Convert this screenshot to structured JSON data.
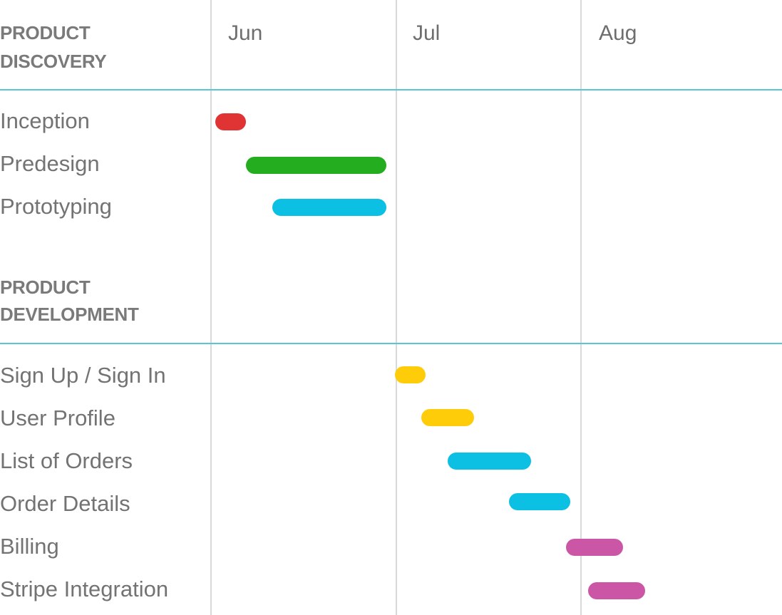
{
  "chart_data": {
    "type": "gantt",
    "title": "",
    "months": [
      "Jun",
      "Jul",
      "Aug"
    ],
    "x_unit": "weeks from start of Jun",
    "groups": [
      {
        "title_lines": [
          "PRODUCT",
          "DISCOVERY"
        ],
        "tasks": [
          {
            "name": "Inception",
            "start": 0.1,
            "end": 0.8,
            "color": "#e03434"
          },
          {
            "name": "Predesign",
            "start": 0.8,
            "end": 4.0,
            "color": "#25ad20"
          },
          {
            "name": "Prototyping",
            "start": 1.4,
            "end": 4.0,
            "color": "#0bc0e3"
          }
        ]
      },
      {
        "title_lines": [
          "PRODUCT",
          "DEVELOPMENT"
        ],
        "tasks": [
          {
            "name": "Sign Up / Sign In",
            "start": 4.2,
            "end": 4.9,
            "color": "#ffcc0a"
          },
          {
            "name": "User Profile",
            "start": 4.8,
            "end": 6.0,
            "color": "#ffcc0a"
          },
          {
            "name": "List of Orders",
            "start": 5.4,
            "end": 7.3,
            "color": "#0bc0e3"
          },
          {
            "name": "Order Details",
            "start": 6.8,
            "end": 8.2,
            "color": "#0bc0e3"
          },
          {
            "name": "Billing",
            "start": 8.1,
            "end": 9.4,
            "color": "#cc56a6"
          },
          {
            "name": "Stripe Integration",
            "start": 8.6,
            "end": 9.9,
            "color": "#cc56a6"
          }
        ]
      }
    ]
  }
}
